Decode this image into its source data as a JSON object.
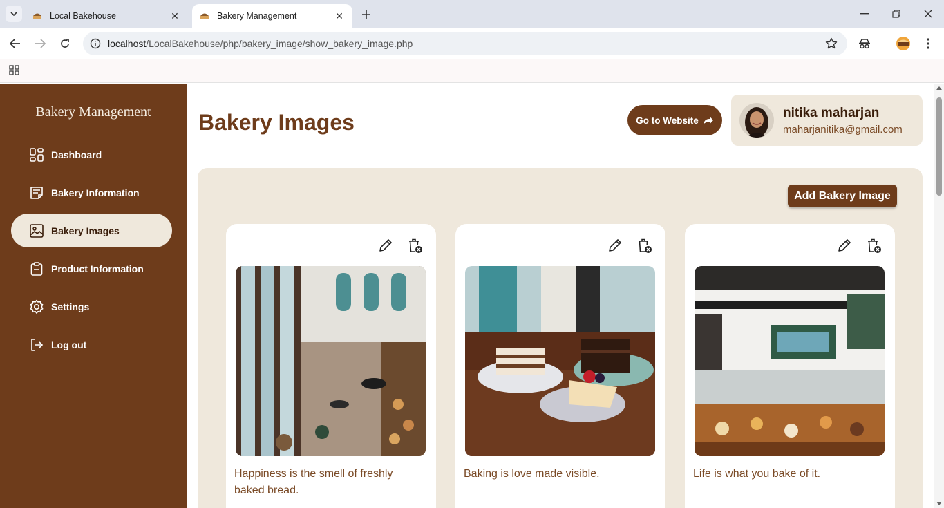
{
  "browser": {
    "tabs": [
      {
        "title": "Local Bakehouse",
        "active": false
      },
      {
        "title": "Bakery Management",
        "active": true
      }
    ],
    "url_host": "localhost",
    "url_path": "/LocalBakehouse/php/bakery_image/show_bakery_image.php"
  },
  "sidebar": {
    "brand": "Bakery Management",
    "items": [
      {
        "label": "Dashboard",
        "icon": "dashboard-icon"
      },
      {
        "label": "Bakery Information",
        "icon": "info-icon"
      },
      {
        "label": "Bakery Images",
        "icon": "image-icon",
        "active": true
      },
      {
        "label": "Product Information",
        "icon": "clipboard-icon"
      },
      {
        "label": "Settings",
        "icon": "gear-icon"
      },
      {
        "label": "Log out",
        "icon": "logout-icon"
      }
    ]
  },
  "header": {
    "title": "Bakery Images",
    "go_website": "Go to Website",
    "user_name": "nitika maharjan",
    "user_email": "maharjanitika@gmail.com"
  },
  "panel": {
    "add_button": "Add Bakery Image",
    "cards": [
      {
        "caption": "Happiness is the smell of freshly baked bread.",
        "image": "bakery-interior-photo"
      },
      {
        "caption": "Baking is love made visible.",
        "image": "cake-slices-photo"
      },
      {
        "caption": "Life is what you bake of it.",
        "image": "pastry-counter-photo"
      }
    ]
  },
  "colors": {
    "brand_brown": "#6e3c1b",
    "cream": "#efe8dc"
  }
}
